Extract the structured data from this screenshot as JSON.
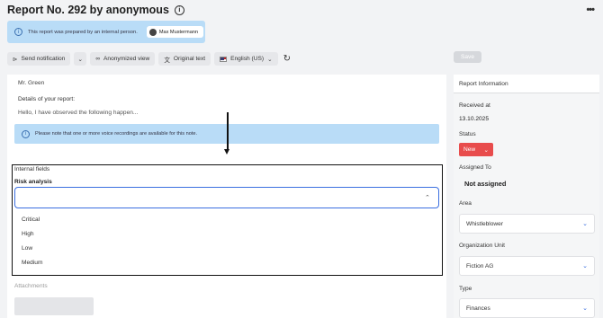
{
  "header": {
    "title": "Report No. 292 by anonymous",
    "info_icon": "info-icon",
    "menu_icon": "kebab-menu-icon"
  },
  "banner": {
    "text": "This report was prepared by an internal person.",
    "person": "Max Mustermann"
  },
  "toolbar": {
    "send_notification": "Send notification",
    "anonymized_view": "Anonymized view",
    "original_text": "Original text",
    "language": "English (US)",
    "save": "Save"
  },
  "report": {
    "recipient": "Mr. Green",
    "details_label": "Details of your report:",
    "details_text": "Hello, I have observed the following happen...",
    "voice_note": "Please note that one or more voice recordings are available for this note."
  },
  "internal_fields": {
    "title": "Internal fields",
    "risk_label": "Risk analysis",
    "risk_value": "",
    "options": [
      "Critical",
      "High",
      "Low",
      "Medium"
    ]
  },
  "attachments": {
    "label": "Attachments"
  },
  "sidebar": {
    "title": "Report Information",
    "received_label": "Received at",
    "received_value": "13.10.2025",
    "status_label": "Status",
    "status_value": "New",
    "assigned_label": "Assigned To",
    "assigned_value": "Not assigned",
    "area_label": "Area",
    "area_value": "Whistleblower",
    "org_label": "Organization Unit",
    "org_value": "Fiction AG",
    "type_label": "Type",
    "type_value": "Finances"
  },
  "colors": {
    "banner_bg": "#b9dcf7",
    "status_new": "#e84c4c",
    "focus_blue": "#3b6fe0"
  }
}
